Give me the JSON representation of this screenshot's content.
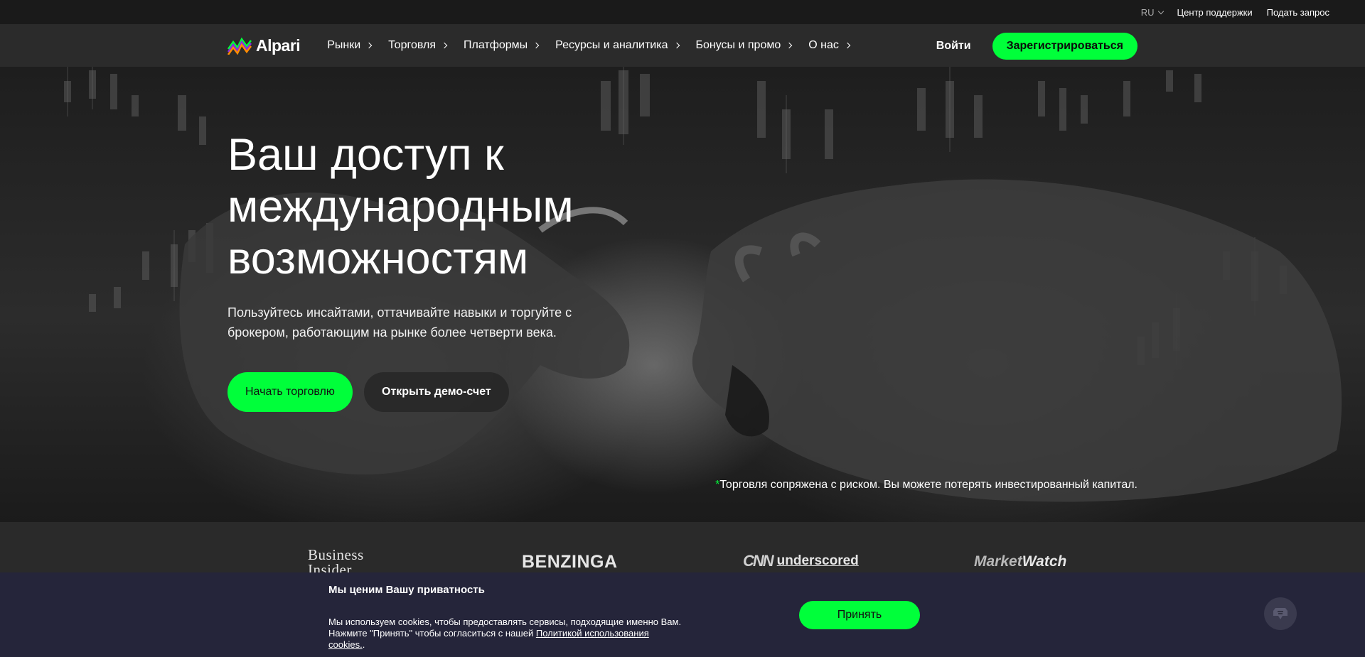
{
  "topbar": {
    "lang": "RU",
    "support": "Центр поддержки",
    "request": "Подать запрос"
  },
  "nav": {
    "logo": "Alpari",
    "menu": [
      "Рынки",
      "Торговля",
      "Платформы",
      "Ресурсы и аналитика",
      "Бонусы и промо",
      "О нас"
    ],
    "login": "Войти",
    "register": "Зарегистрироваться"
  },
  "hero": {
    "title": "Ваш доступ к международным возможностям",
    "subtitle": "Пользуйтесь инсайтами, оттачивайте навыки и торгуйте с брокером, работающим на рынке более четверти века.",
    "cta_primary": "Начать торговлю",
    "cta_demo": "Открыть демо-счет",
    "risk_star": "*",
    "risk_text": "Торговля сопряжена с риском. Вы можете потерять инвестированный капитал."
  },
  "press": {
    "business_insider_1": "Business",
    "business_insider_2": "Insider",
    "benzinga": "BENZINGA",
    "cnn_mark": "CNN",
    "cnn_underscored": "underscored",
    "mw_light": "Market",
    "mw_bold": "Watch"
  },
  "cookie": {
    "title": "Мы ценим Вашу приватность",
    "text_before": "Мы используем cookies, чтобы предоставлять сервисы, подходящие именно Вам. Нажмите \"Принять\" чтобы согласиться с нашей ",
    "link": "Политикой использования cookies.",
    "text_after": ".",
    "accept": "Принять"
  },
  "colors": {
    "accent": "#00ff3a",
    "nav_bg": "#2b2b2b",
    "topbar_bg": "#1a1a1a",
    "cookie_bg": "#25253a"
  },
  "icons": [
    "alpari-logo-icon",
    "chevron-down-icon",
    "chevron-right-icon",
    "chat-icon"
  ]
}
